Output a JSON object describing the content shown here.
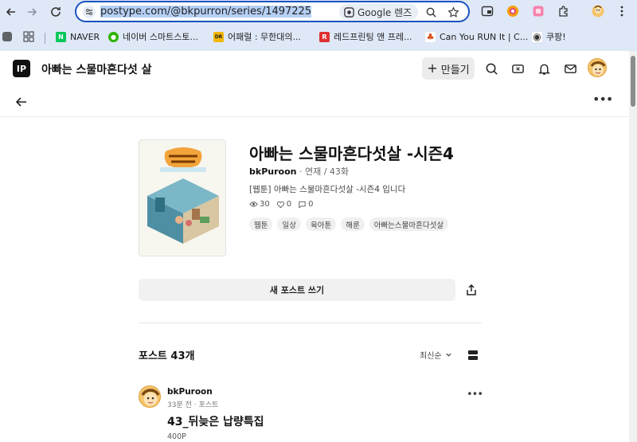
{
  "browser": {
    "url_prefix": "postype.com/@bkpurron/series/1497225",
    "lens_label": "Google 렌즈",
    "bookmarks": [
      {
        "label": "NAVER",
        "color": "#03c75a",
        "glyph": "N"
      },
      {
        "label": "네이버 스마트스토...",
        "color": "#2db400",
        "glyph": "●"
      },
      {
        "label": "어패럴 : 무한대의...",
        "color": "#f2b705",
        "glyph": "DR"
      },
      {
        "label": "레드프린팅 앤 프레...",
        "color": "#e03131",
        "glyph": "R"
      },
      {
        "label": "Can You RUN It | C...",
        "color": "#d9480f",
        "glyph": "♣"
      },
      {
        "label": "쿠팡!",
        "color": "#333333",
        "glyph": "◉"
      }
    ]
  },
  "topbar": {
    "logo_text": "IP",
    "series_title": "아빠는 스물마흔다섯 살",
    "make_label": "만들기"
  },
  "series": {
    "title": "아빠는 스물마흔다섯살 -시즌4",
    "author": "bkPuroon",
    "status": "연재 / 43화",
    "description": "[웹툰] 아빠는 스물마흔다섯살 -시즌4 입니다",
    "views": "30",
    "likes": "0",
    "comments": "0",
    "tags": [
      "웹툰",
      "일상",
      "육아툰",
      "해룬",
      "아빠는스물마흔다섯살"
    ]
  },
  "actions": {
    "new_post_label": "새 포스트 쓰기"
  },
  "posts": {
    "header": "포스트 43개",
    "sort_label": "최신순",
    "items": [
      {
        "author": "bkPuroon",
        "meta": "33분 전 · 포스트",
        "title": "43_뒤늦은 납량특집",
        "price": "400P"
      }
    ]
  }
}
